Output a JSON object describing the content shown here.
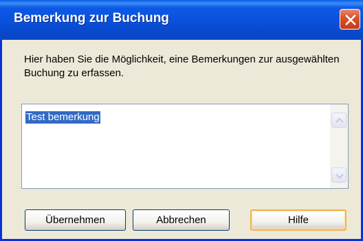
{
  "window": {
    "title": "Bemerkung zur Buchung"
  },
  "message": "Hier haben Sie die Möglichkeit, eine Bemerkungen zur ausgewählten Buchung zu erfassen.",
  "remark_field": {
    "value": "Test bemerkung",
    "selected": true
  },
  "buttons": {
    "apply": "Übernehmen",
    "cancel": "Abbrechen",
    "help": "Hilfe"
  },
  "colors": {
    "titlebar": "#0a4fd9",
    "close_button": "#d9542c",
    "dialog_background": "#ece9d8",
    "selection": "#316ac5",
    "default_button_highlight": "#f5b24a"
  },
  "icons": [
    "close-icon",
    "scroll-up-arrow-icon",
    "scroll-down-arrow-icon"
  ]
}
